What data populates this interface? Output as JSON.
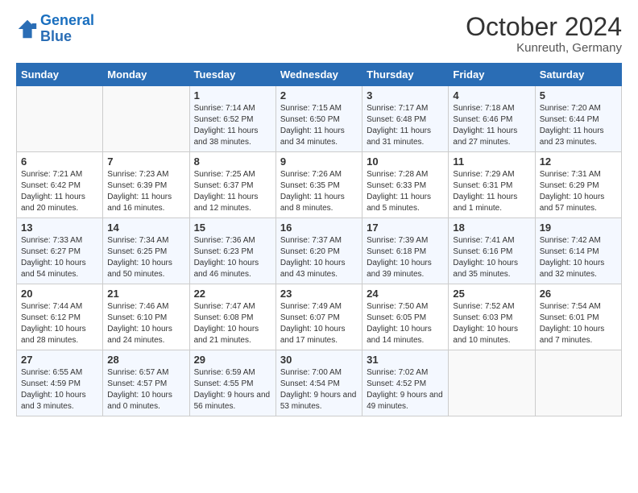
{
  "header": {
    "logo_general": "General",
    "logo_blue": "Blue",
    "month": "October 2024",
    "location": "Kunreuth, Germany"
  },
  "days_of_week": [
    "Sunday",
    "Monday",
    "Tuesday",
    "Wednesday",
    "Thursday",
    "Friday",
    "Saturday"
  ],
  "weeks": [
    [
      {
        "day": "",
        "empty": true
      },
      {
        "day": "",
        "empty": true
      },
      {
        "day": "1",
        "sunrise": "Sunrise: 7:14 AM",
        "sunset": "Sunset: 6:52 PM",
        "daylight": "Daylight: 11 hours and 38 minutes."
      },
      {
        "day": "2",
        "sunrise": "Sunrise: 7:15 AM",
        "sunset": "Sunset: 6:50 PM",
        "daylight": "Daylight: 11 hours and 34 minutes."
      },
      {
        "day": "3",
        "sunrise": "Sunrise: 7:17 AM",
        "sunset": "Sunset: 6:48 PM",
        "daylight": "Daylight: 11 hours and 31 minutes."
      },
      {
        "day": "4",
        "sunrise": "Sunrise: 7:18 AM",
        "sunset": "Sunset: 6:46 PM",
        "daylight": "Daylight: 11 hours and 27 minutes."
      },
      {
        "day": "5",
        "sunrise": "Sunrise: 7:20 AM",
        "sunset": "Sunset: 6:44 PM",
        "daylight": "Daylight: 11 hours and 23 minutes."
      }
    ],
    [
      {
        "day": "6",
        "sunrise": "Sunrise: 7:21 AM",
        "sunset": "Sunset: 6:42 PM",
        "daylight": "Daylight: 11 hours and 20 minutes."
      },
      {
        "day": "7",
        "sunrise": "Sunrise: 7:23 AM",
        "sunset": "Sunset: 6:39 PM",
        "daylight": "Daylight: 11 hours and 16 minutes."
      },
      {
        "day": "8",
        "sunrise": "Sunrise: 7:25 AM",
        "sunset": "Sunset: 6:37 PM",
        "daylight": "Daylight: 11 hours and 12 minutes."
      },
      {
        "day": "9",
        "sunrise": "Sunrise: 7:26 AM",
        "sunset": "Sunset: 6:35 PM",
        "daylight": "Daylight: 11 hours and 8 minutes."
      },
      {
        "day": "10",
        "sunrise": "Sunrise: 7:28 AM",
        "sunset": "Sunset: 6:33 PM",
        "daylight": "Daylight: 11 hours and 5 minutes."
      },
      {
        "day": "11",
        "sunrise": "Sunrise: 7:29 AM",
        "sunset": "Sunset: 6:31 PM",
        "daylight": "Daylight: 11 hours and 1 minute."
      },
      {
        "day": "12",
        "sunrise": "Sunrise: 7:31 AM",
        "sunset": "Sunset: 6:29 PM",
        "daylight": "Daylight: 10 hours and 57 minutes."
      }
    ],
    [
      {
        "day": "13",
        "sunrise": "Sunrise: 7:33 AM",
        "sunset": "Sunset: 6:27 PM",
        "daylight": "Daylight: 10 hours and 54 minutes."
      },
      {
        "day": "14",
        "sunrise": "Sunrise: 7:34 AM",
        "sunset": "Sunset: 6:25 PM",
        "daylight": "Daylight: 10 hours and 50 minutes."
      },
      {
        "day": "15",
        "sunrise": "Sunrise: 7:36 AM",
        "sunset": "Sunset: 6:23 PM",
        "daylight": "Daylight: 10 hours and 46 minutes."
      },
      {
        "day": "16",
        "sunrise": "Sunrise: 7:37 AM",
        "sunset": "Sunset: 6:20 PM",
        "daylight": "Daylight: 10 hours and 43 minutes."
      },
      {
        "day": "17",
        "sunrise": "Sunrise: 7:39 AM",
        "sunset": "Sunset: 6:18 PM",
        "daylight": "Daylight: 10 hours and 39 minutes."
      },
      {
        "day": "18",
        "sunrise": "Sunrise: 7:41 AM",
        "sunset": "Sunset: 6:16 PM",
        "daylight": "Daylight: 10 hours and 35 minutes."
      },
      {
        "day": "19",
        "sunrise": "Sunrise: 7:42 AM",
        "sunset": "Sunset: 6:14 PM",
        "daylight": "Daylight: 10 hours and 32 minutes."
      }
    ],
    [
      {
        "day": "20",
        "sunrise": "Sunrise: 7:44 AM",
        "sunset": "Sunset: 6:12 PM",
        "daylight": "Daylight: 10 hours and 28 minutes."
      },
      {
        "day": "21",
        "sunrise": "Sunrise: 7:46 AM",
        "sunset": "Sunset: 6:10 PM",
        "daylight": "Daylight: 10 hours and 24 minutes."
      },
      {
        "day": "22",
        "sunrise": "Sunrise: 7:47 AM",
        "sunset": "Sunset: 6:08 PM",
        "daylight": "Daylight: 10 hours and 21 minutes."
      },
      {
        "day": "23",
        "sunrise": "Sunrise: 7:49 AM",
        "sunset": "Sunset: 6:07 PM",
        "daylight": "Daylight: 10 hours and 17 minutes."
      },
      {
        "day": "24",
        "sunrise": "Sunrise: 7:50 AM",
        "sunset": "Sunset: 6:05 PM",
        "daylight": "Daylight: 10 hours and 14 minutes."
      },
      {
        "day": "25",
        "sunrise": "Sunrise: 7:52 AM",
        "sunset": "Sunset: 6:03 PM",
        "daylight": "Daylight: 10 hours and 10 minutes."
      },
      {
        "day": "26",
        "sunrise": "Sunrise: 7:54 AM",
        "sunset": "Sunset: 6:01 PM",
        "daylight": "Daylight: 10 hours and 7 minutes."
      }
    ],
    [
      {
        "day": "27",
        "sunrise": "Sunrise: 6:55 AM",
        "sunset": "Sunset: 4:59 PM",
        "daylight": "Daylight: 10 hours and 3 minutes."
      },
      {
        "day": "28",
        "sunrise": "Sunrise: 6:57 AM",
        "sunset": "Sunset: 4:57 PM",
        "daylight": "Daylight: 10 hours and 0 minutes."
      },
      {
        "day": "29",
        "sunrise": "Sunrise: 6:59 AM",
        "sunset": "Sunset: 4:55 PM",
        "daylight": "Daylight: 9 hours and 56 minutes."
      },
      {
        "day": "30",
        "sunrise": "Sunrise: 7:00 AM",
        "sunset": "Sunset: 4:54 PM",
        "daylight": "Daylight: 9 hours and 53 minutes."
      },
      {
        "day": "31",
        "sunrise": "Sunrise: 7:02 AM",
        "sunset": "Sunset: 4:52 PM",
        "daylight": "Daylight: 9 hours and 49 minutes."
      },
      {
        "day": "",
        "empty": true
      },
      {
        "day": "",
        "empty": true
      }
    ]
  ]
}
